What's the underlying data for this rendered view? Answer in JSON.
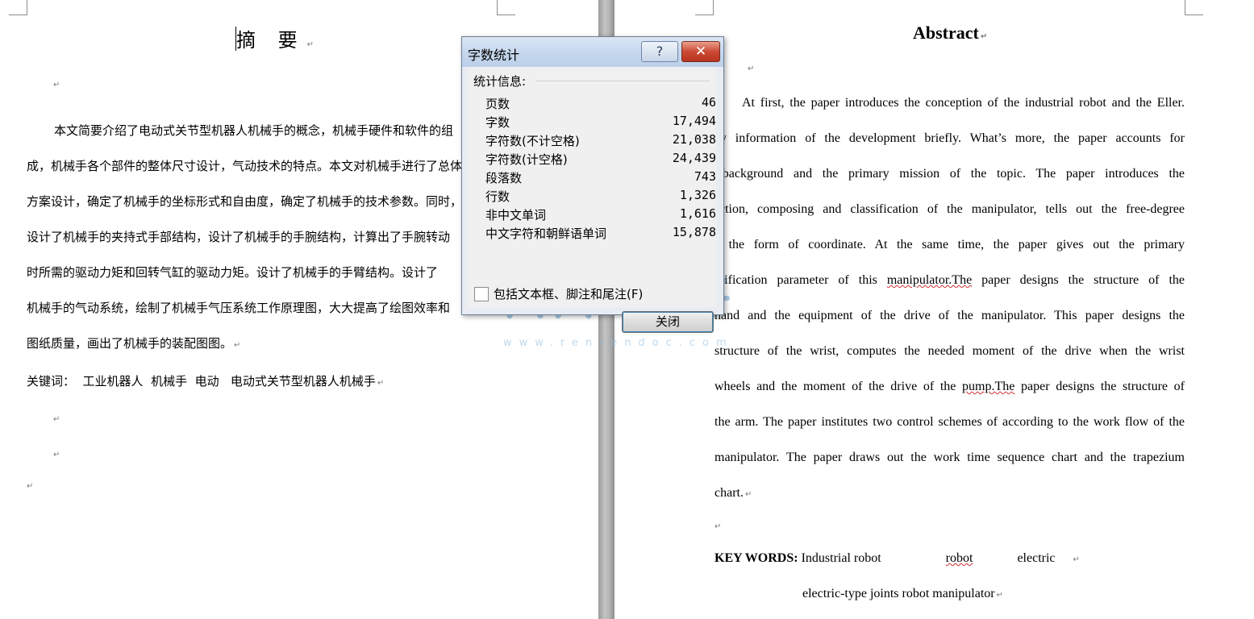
{
  "left_page": {
    "title": "摘 要",
    "paragraph_lines": [
      "本文简要介绍了电动式关节型机器人机械手的概念，机械手硬件和软件的组",
      "成，机械手各个部件的整体尺寸设计，气动技术的特点。本文对机械手进行了总体",
      "方案设计，确定了机械手的坐标形式和自由度，确定了机械手的技术参数。同时，",
      "设计了机械手的夹持式手部结构，设计了机械手的手腕结构，计算出了手腕转动",
      "时所需的驱动力矩和回转气缸的驱动力矩。设计了机械手的手臂结构。设计了",
      "机械手的气动系统，绘制了机械手气压系统工作原理图，大大提高了绘图效率和",
      "图纸质量，画出了机械手的装配图图。"
    ],
    "keywords": "关键词：  工业机器人  机械手  电动   电动式关节型机器人机械手"
  },
  "right_page": {
    "title": "Abstract",
    "lines": [
      "At first, the paper introduces the conception of the industrial robot and the Eller.",
      "airy   information of the development briefly. What’s more, the paper accounts for",
      "e background and the primary mission of the topic.  The paper introduces the",
      "unction, composing and classification of the manipulator, tells out the free-degree",
      "nd the form of coordinate. At the same time, the paper gives out the primary",
      "pecification parameter of this",
      "manipulator.The",
      "paper designs the structure of the",
      "hand and the equipment of the drive of the manipulator. This paper designs the",
      "structure of the wrist, computes the needed moment of the drive when the wrist",
      "wheels and the moment of the drive of the",
      "pump.The",
      "paper designs the structure of",
      "the arm. The paper institutes two control schemes of according to the work flow of the",
      "manipulator. The paper draws out the work time sequence chart and the trapezium",
      "chart."
    ],
    "keywords_label": "KEY WORDS:",
    "keywords_1": "Industrial robot",
    "keywords_2": "robot",
    "keywords_3": "electric",
    "keywords_4": "electric-type joints robot manipulator"
  },
  "dialog": {
    "title": "字数统计",
    "help_label": "?",
    "close_glyph": "✕",
    "section_label": "统计信息:",
    "stats": [
      {
        "label": "页数",
        "value": "46"
      },
      {
        "label": "字数",
        "value": "17,494"
      },
      {
        "label": "字符数(不计空格)",
        "value": "21,038"
      },
      {
        "label": "字符数(计空格)",
        "value": "24,439"
      },
      {
        "label": "段落数",
        "value": "743"
      },
      {
        "label": "行数",
        "value": "1,326"
      },
      {
        "label": "非中文单词",
        "value": "1,616"
      },
      {
        "label": "中文字符和朝鲜语单词",
        "value": "15,878"
      }
    ],
    "checkbox_label": "包括文本框、脚注和尾注(F)",
    "checkbox_checked": false,
    "close_button_label": "关闭"
  },
  "watermark": {
    "url": "www.renrendoc.com",
    "color": "#6aa8d8"
  },
  "paragraph_mark": "↵"
}
